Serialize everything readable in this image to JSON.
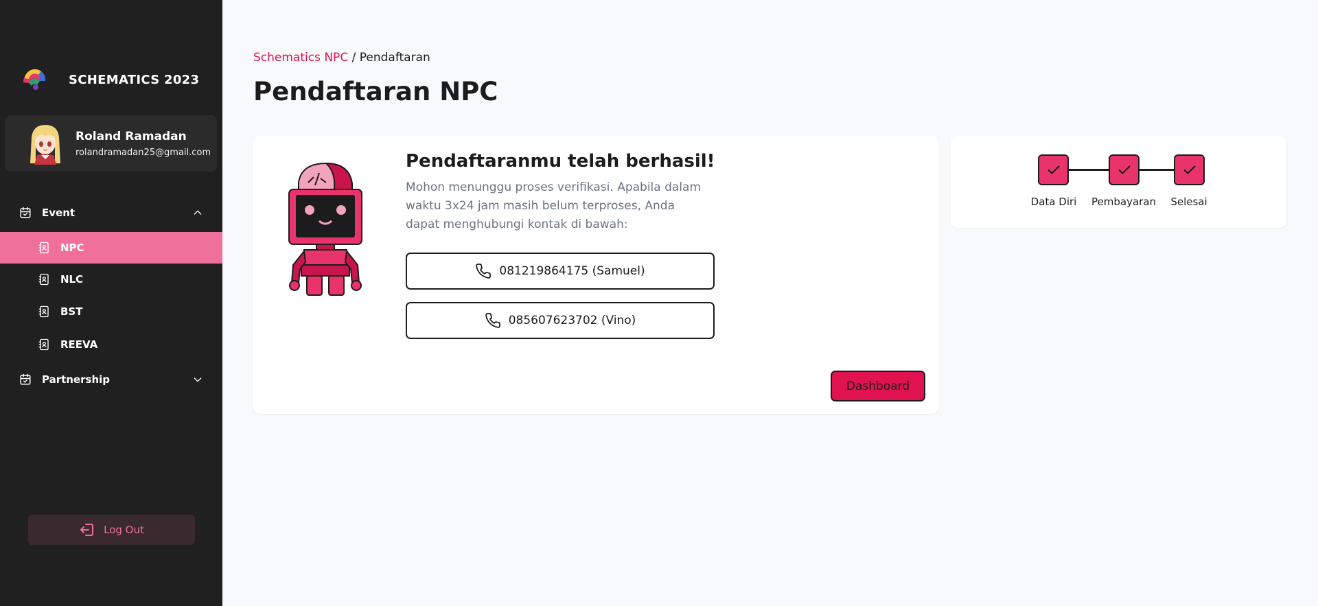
{
  "brand": {
    "name": "SCHEMATICS 2023",
    "logo_icon": "schematics-logo"
  },
  "user": {
    "name": "Roland Ramadan",
    "email": "rolandramadan25@gmail.com"
  },
  "sidebar": {
    "groups": [
      {
        "label": "Event",
        "icon": "calendar-check-icon",
        "expanded": true
      },
      {
        "label": "Partnership",
        "icon": "calendar-check-icon",
        "expanded": false
      }
    ],
    "items": [
      {
        "label": "NPC",
        "icon": "contact-list-icon",
        "active": true
      },
      {
        "label": "NLC",
        "icon": "contact-list-icon",
        "active": false
      },
      {
        "label": "BST",
        "icon": "contact-list-icon",
        "active": false
      },
      {
        "label": "REEVA",
        "icon": "contact-list-icon",
        "active": false
      }
    ],
    "logout_label": "Log Out"
  },
  "breadcrumb": {
    "link": "Schematics NPC",
    "separator": " / ",
    "current": "Pendaftaran"
  },
  "page_title": "Pendaftaran NPC",
  "main_card": {
    "title": "Pendaftaranmu telah berhasil!",
    "description": "Mohon menunggu proses verifikasi. Apabila dalam waktu 3x24 jam masih belum terproses, Anda dapat menghubungi kontak di bawah:",
    "contacts": [
      {
        "label": "081219864175 (Samuel)",
        "icon": "phone-icon"
      },
      {
        "label": "085607623702 (Vino)",
        "icon": "phone-icon"
      }
    ],
    "dashboard_label": "Dashboard"
  },
  "steps": [
    {
      "label": "Data Diri",
      "done": true
    },
    {
      "label": "Pembayaran",
      "done": true
    },
    {
      "label": "Selesai",
      "done": true
    }
  ],
  "colors": {
    "accent": "#e0124f",
    "sidebar_bg": "#202020",
    "active_item": "#f0709c",
    "step_fill": "#e8336b"
  }
}
